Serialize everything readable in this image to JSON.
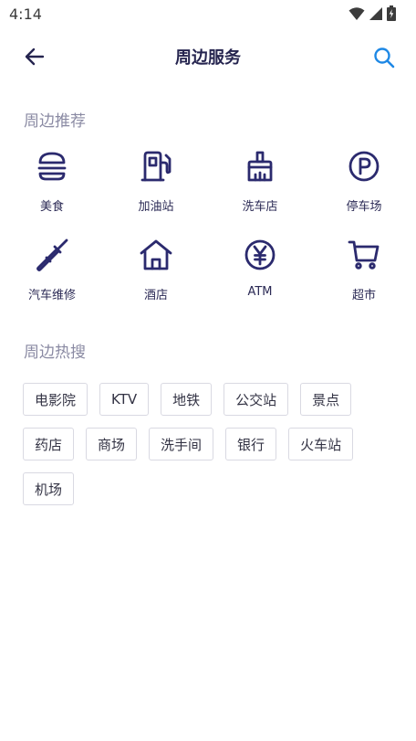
{
  "status_bar": {
    "time": "4:14",
    "icons": [
      "wifi-icon",
      "signal-icon",
      "battery-charging-icon"
    ]
  },
  "app_bar": {
    "back_icon": "arrow-left-icon",
    "title": "周边服务",
    "search_icon": "search-icon",
    "accent_color": "#1e88e5"
  },
  "recommend": {
    "title": "周边推荐",
    "items": [
      {
        "label": "美食",
        "icon": "burger-icon"
      },
      {
        "label": "加油站",
        "icon": "fuel-pump-icon"
      },
      {
        "label": "洗车店",
        "icon": "brush-icon"
      },
      {
        "label": "停车场",
        "icon": "parking-icon"
      },
      {
        "label": "汽车维修",
        "icon": "screwdriver-icon"
      },
      {
        "label": "酒店",
        "icon": "house-icon"
      },
      {
        "label": "ATM",
        "icon": "yen-icon"
      },
      {
        "label": "超市",
        "icon": "cart-icon"
      }
    ]
  },
  "hot_search": {
    "title": "周边热搜",
    "tags": [
      "电影院",
      "KTV",
      "地铁",
      "公交站",
      "景点",
      "药店",
      "商场",
      "洗手间",
      "银行",
      "火车站",
      "机场"
    ]
  },
  "icon_color": "#2b2a6e"
}
